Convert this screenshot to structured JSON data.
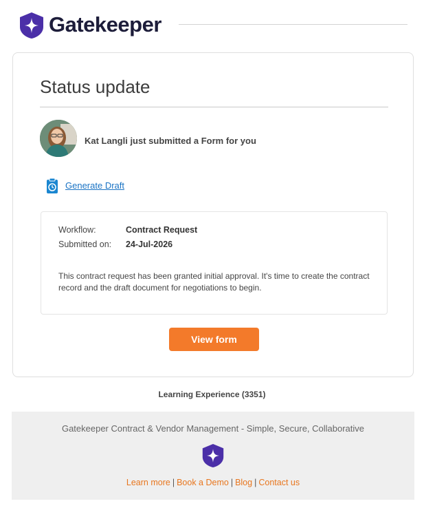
{
  "header": {
    "brand": "Gatekeeper"
  },
  "card": {
    "title": "Status update",
    "submitter_message": "Kat Langli just submitted a Form for you",
    "generate_link": "Generate Draft",
    "details": {
      "workflow_label": "Workflow:",
      "workflow_value": "Contract Request",
      "submitted_label": "Submitted on:",
      "submitted_value": "24-Jul-2026",
      "description": "This contract request has been granted initial approval. It's time to create the contract record and the draft document for negotiations to begin."
    },
    "view_button": "View form"
  },
  "org_name": "Learning Experience (3351)",
  "footer": {
    "tagline": "Gatekeeper Contract & Vendor Management - Simple, Secure, Collaborative",
    "links": [
      "Learn more",
      "Book a Demo",
      "Blog",
      "Contact us"
    ]
  },
  "colors": {
    "brand_purple": "#4b2fa8",
    "accent_orange": "#f37a2a",
    "link_blue": "#1a73c4"
  },
  "icons": {
    "logo": "shield-star-icon",
    "generate": "clipboard-clock-icon"
  }
}
